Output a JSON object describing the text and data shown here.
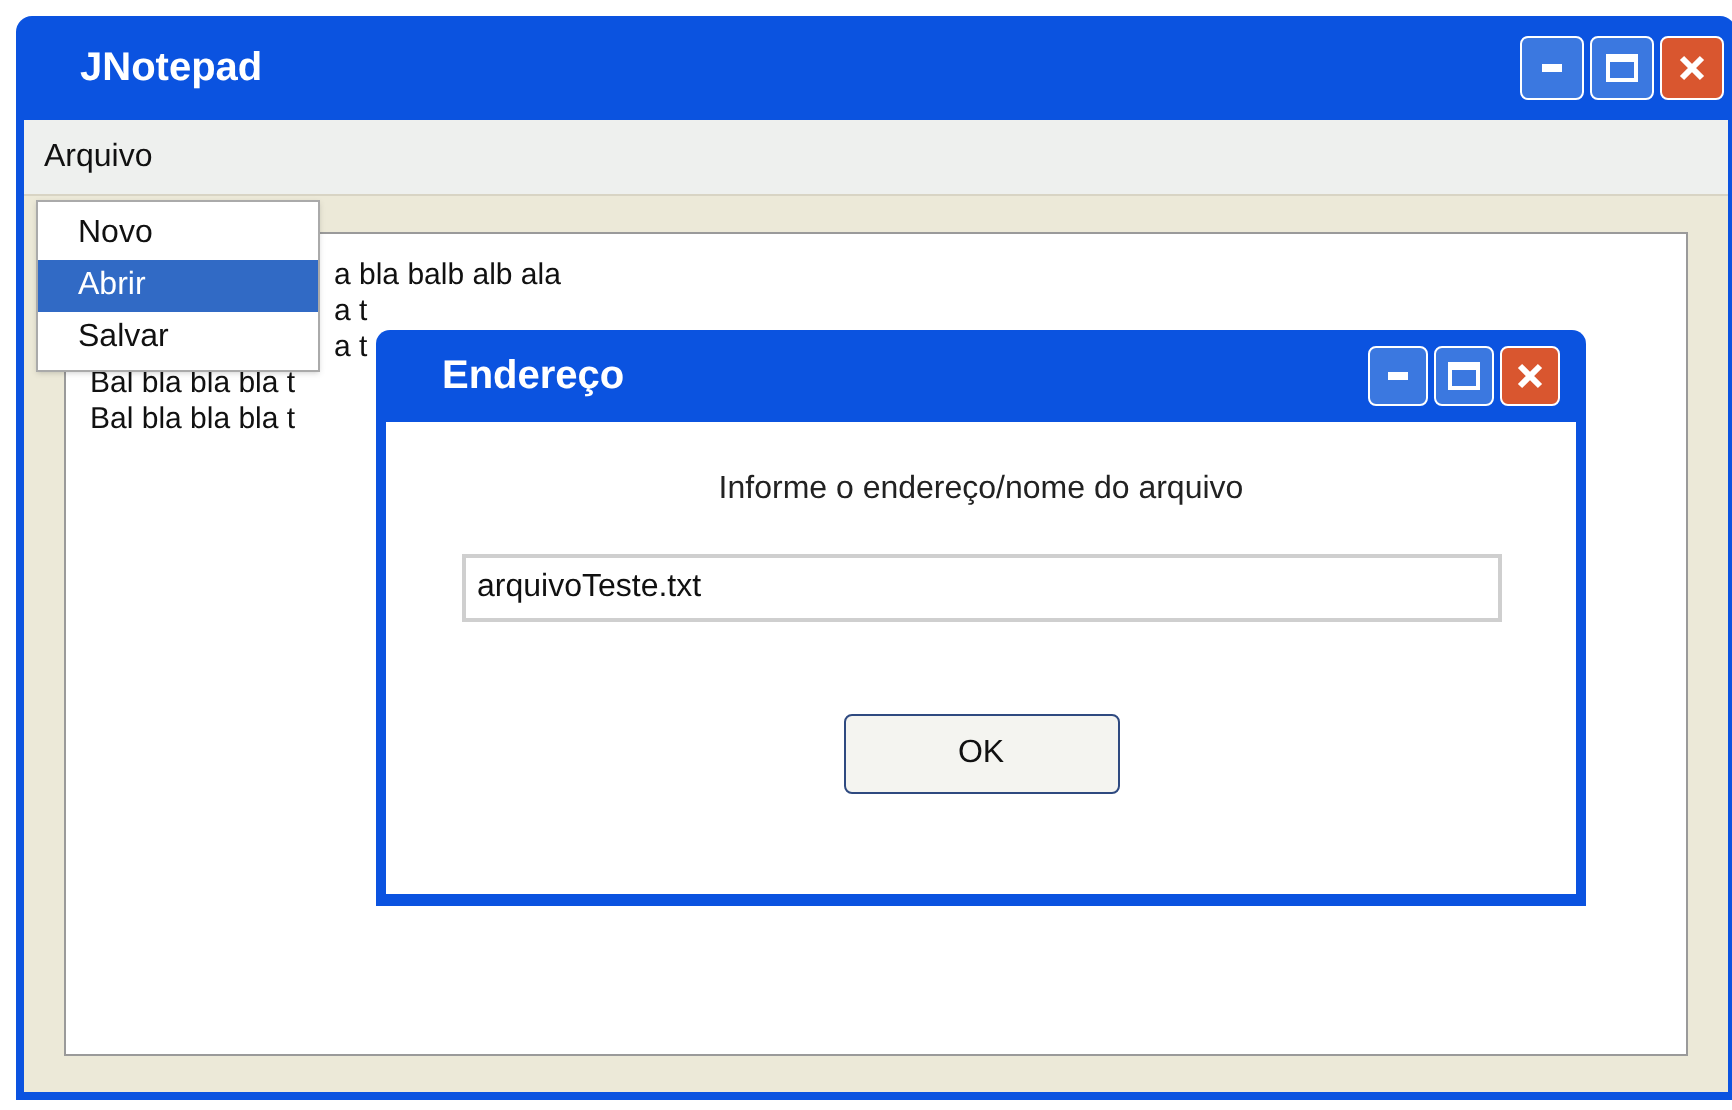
{
  "window": {
    "title": "JNotepad"
  },
  "menubar": [
    {
      "label": "Arquivo"
    }
  ],
  "menu": {
    "items": [
      {
        "label": "Novo",
        "selected": false
      },
      {
        "label": "Abrir",
        "selected": true
      },
      {
        "label": "Salvar",
        "selected": false
      }
    ]
  },
  "editor": {
    "lines": [
      {
        "kind": "partial",
        "text": "a bla balb alb ala"
      },
      {
        "kind": "partial",
        "text": "a t"
      },
      {
        "kind": "partial",
        "text": "a t"
      },
      {
        "kind": "full",
        "text": "Bal bla bla bla t"
      },
      {
        "kind": "full",
        "text": "Bal bla bla bla t"
      }
    ]
  },
  "dialog": {
    "title": "Endereço",
    "prompt": "Informe o endereço/nome do arquivo",
    "field": {
      "value": "arquivoTeste.txt"
    },
    "ok_button": "OK"
  }
}
